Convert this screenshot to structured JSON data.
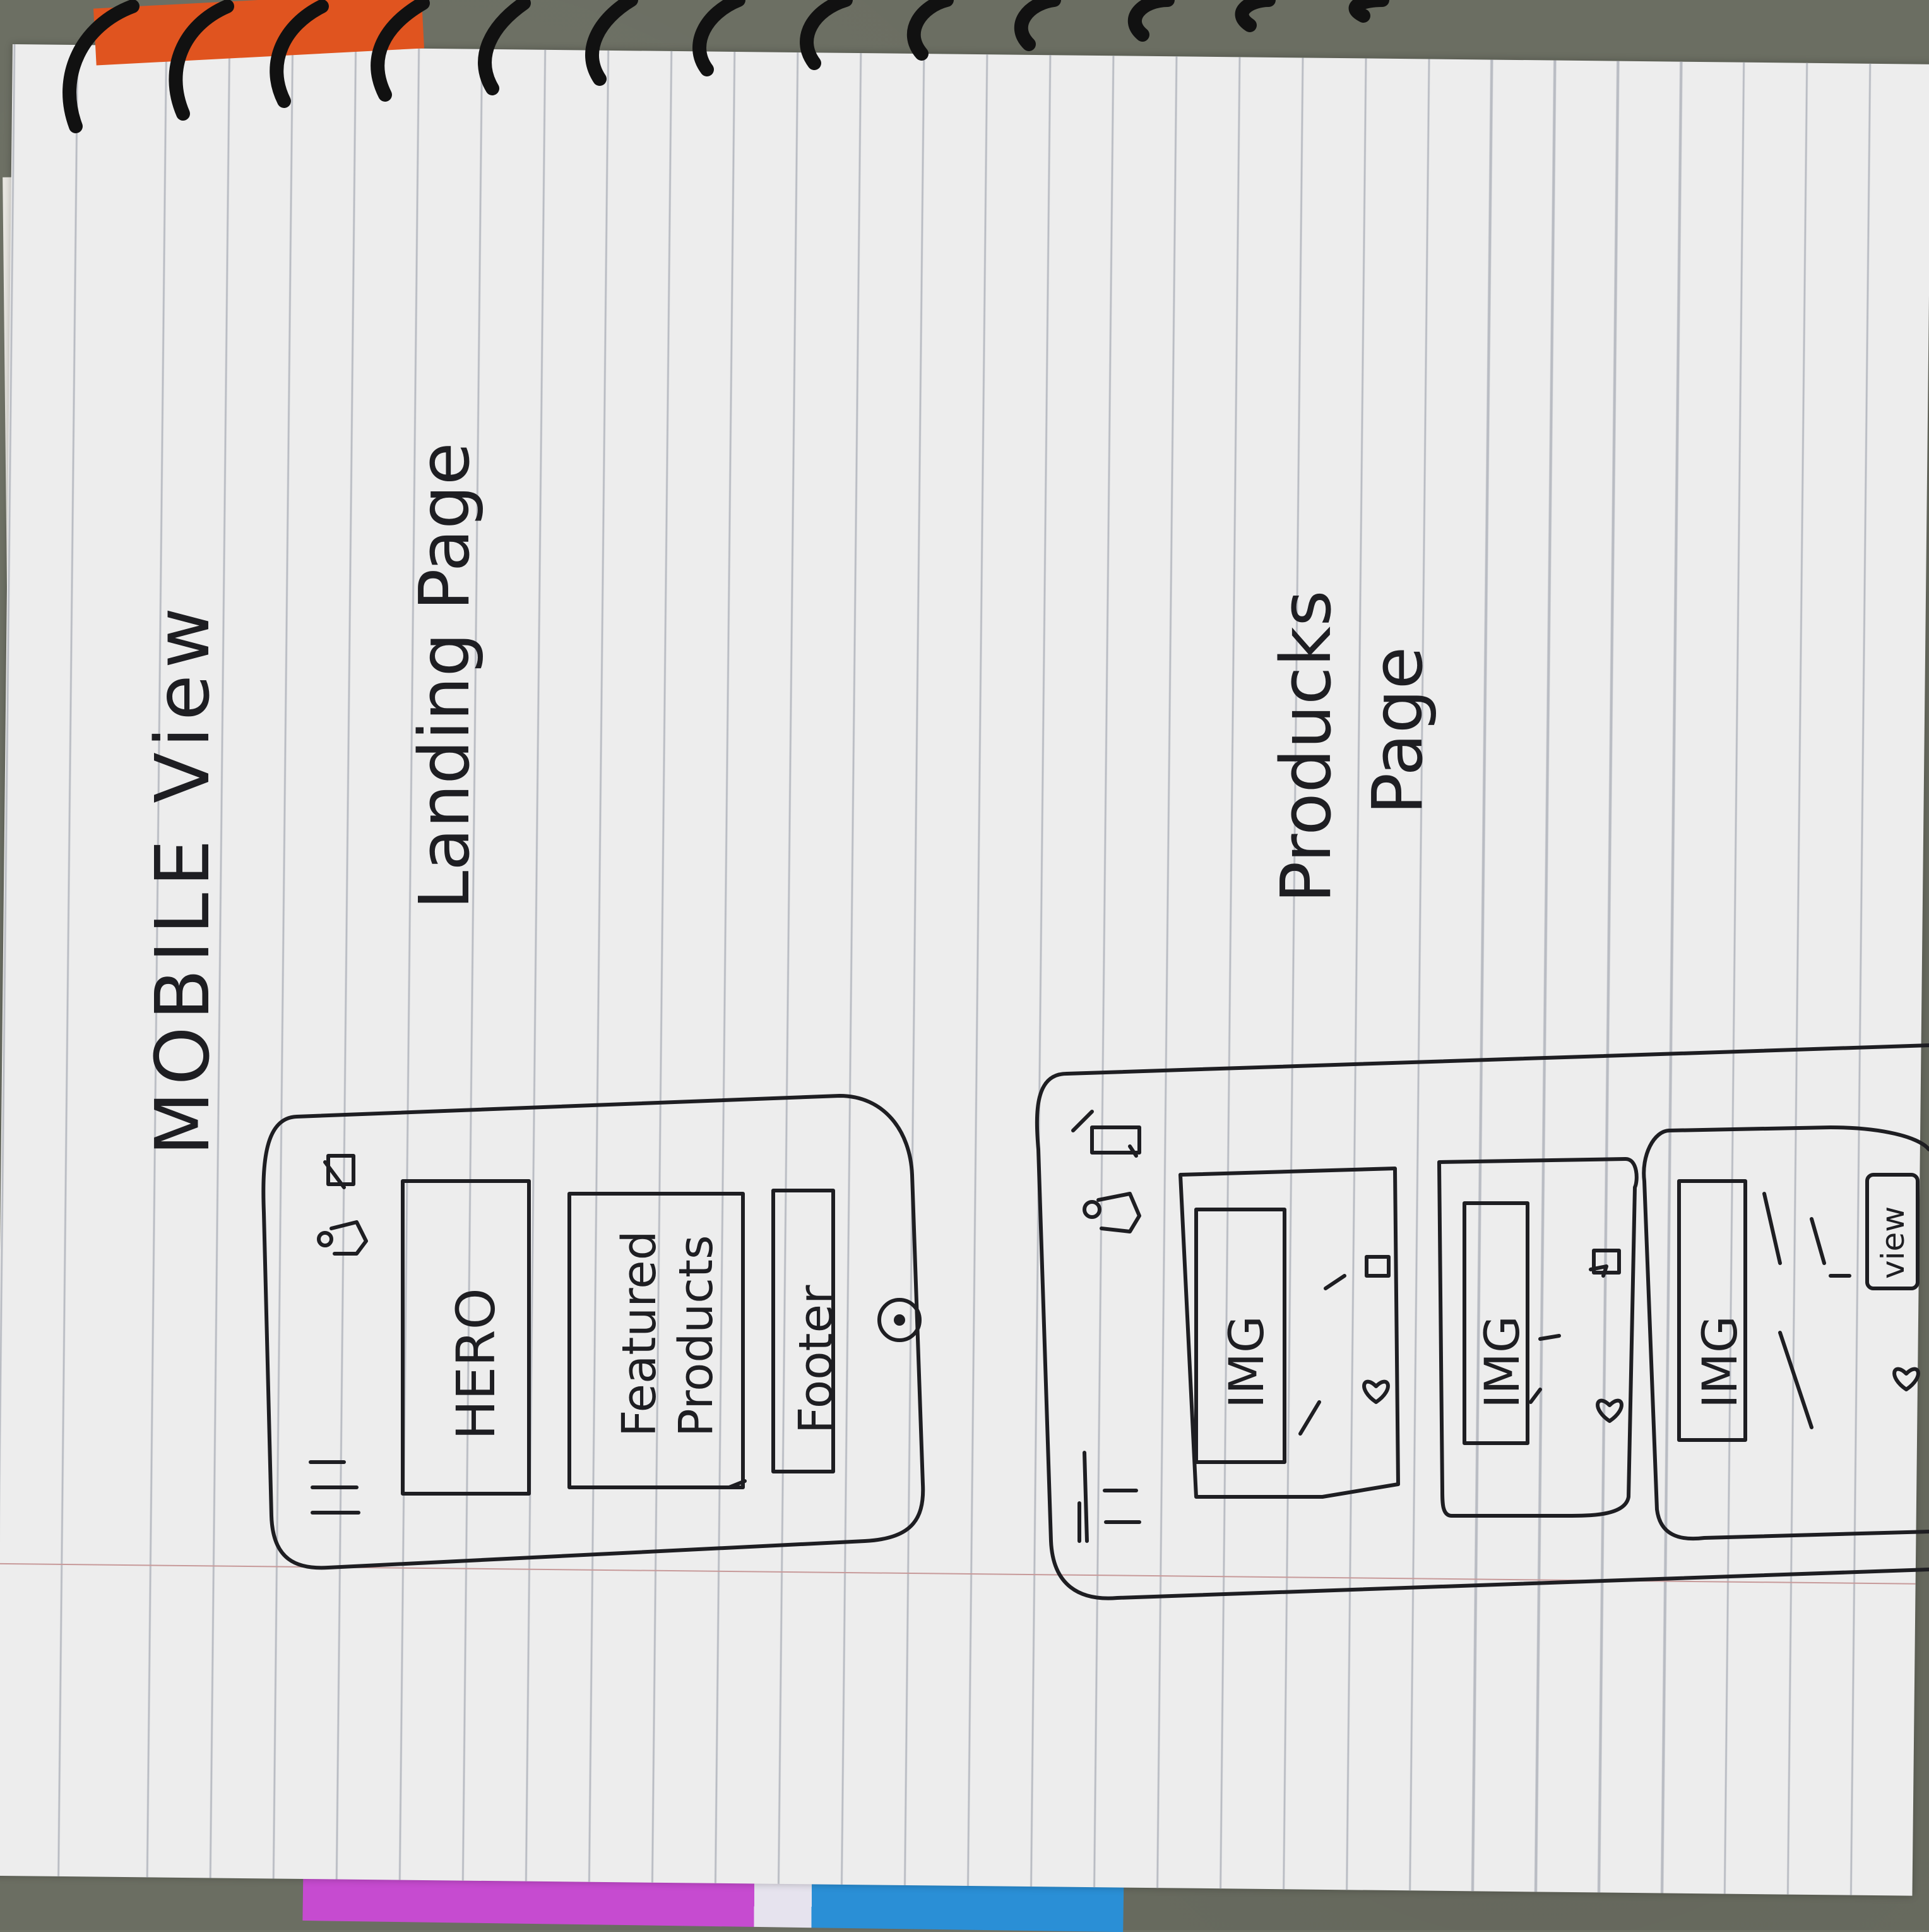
{
  "heading": "MOBILE View",
  "landing_page": {
    "label": "Landing Page",
    "sections": {
      "hero": "HERO",
      "featured_line1": "Featured",
      "featured_line2": "Products",
      "footer": "Footer"
    },
    "icons": [
      "hamburger-menu-icon",
      "user-icon",
      "cart-icon",
      "home-button-icon"
    ]
  },
  "products_page": {
    "label_line1": "Producks",
    "label_line2": "Page",
    "cards": [
      {
        "image": "IMG",
        "action": "",
        "icons": [
          "bookmark-icon",
          "heart-icon"
        ]
      },
      {
        "image": "IMG",
        "action": "",
        "icons": [
          "bookmark-icon",
          "heart-icon"
        ]
      },
      {
        "image": "IMG",
        "action": "view",
        "icons": [
          "heart-icon"
        ]
      }
    ],
    "icons": [
      "hamburger-menu-icon",
      "user-icon",
      "cart-icon"
    ]
  },
  "colors": {
    "ink": "#1e1e22",
    "paper": "#ededed",
    "rule_lines": "#b9bcc3",
    "margin_line": "#c79a9a",
    "orange_tab": "#e0541f",
    "pink_tab": "#c64bd0",
    "blue_tab": "#2a8fd6"
  }
}
